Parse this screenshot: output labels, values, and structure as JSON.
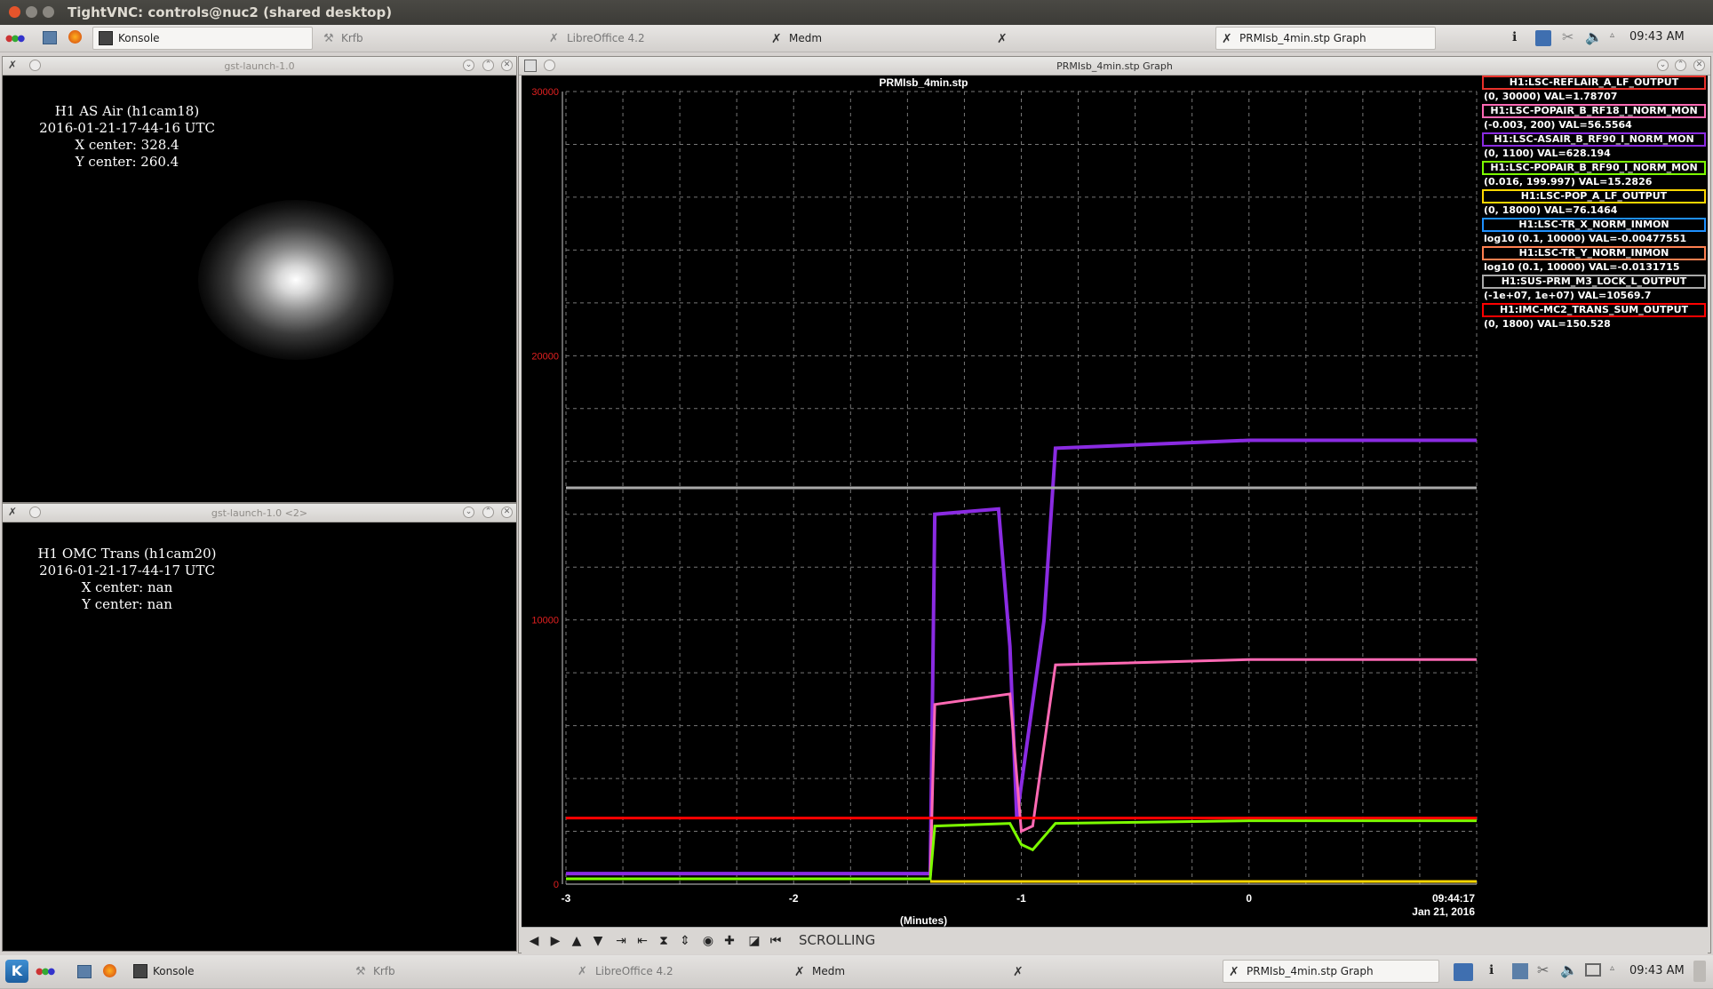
{
  "vnc": {
    "title": "TightVNC: controls@nuc2 (shared desktop)"
  },
  "top_taskbar": {
    "tasks": [
      {
        "label": "Konsole"
      },
      {
        "label": "Krfb"
      },
      {
        "label": "LibreOffice 4.2"
      },
      {
        "label": "Medm"
      },
      {
        "label": ""
      },
      {
        "label": "PRMIsb_4min.stp Graph"
      }
    ],
    "clock": "09:43 AM"
  },
  "bottom_taskbar": {
    "tasks": [
      {
        "label": "Konsole"
      },
      {
        "label": "Krfb"
      },
      {
        "label": "LibreOffice 4.2"
      },
      {
        "label": "Medm"
      },
      {
        "label": ""
      },
      {
        "label": "PRMIsb_4min.stp Graph"
      }
    ],
    "clock": "09:43 AM"
  },
  "camera1": {
    "window_title": "gst-launch-1.0",
    "line1": "H1 AS Air (h1cam18)",
    "line2": "2016-01-21-17-44-16 UTC",
    "line3": "X center: 328.4",
    "line4": "Y center: 260.4"
  },
  "camera2": {
    "window_title": "gst-launch-1.0 <2>",
    "line1": "H1 OMC Trans (h1cam20)",
    "line2": "2016-01-21-17-44-17 UTC",
    "line3": "X center: nan",
    "line4": "Y center: nan"
  },
  "graph_window": {
    "title": "PRMIsb_4min.stp Graph",
    "scrolling_label": "SCROLLING"
  },
  "legend": [
    {
      "name": "H1:LSC-REFLAIR_A_LF_OUTPUT",
      "range": "(0, 30000) VAL=1.78707",
      "color": "#e8312a"
    },
    {
      "name": "H1:LSC-POPAIR_B_RF18_I_NORM_MON",
      "range": "(-0.003, 200) VAL=56.5564",
      "color": "#ff69b4"
    },
    {
      "name": "H1:LSC-ASAIR_B_RF90_I_NORM_MON",
      "range": "(0, 1100) VAL=628.194",
      "color": "#8a2be2"
    },
    {
      "name": "H1:LSC-POPAIR_B_RF90_I_NORM_MON",
      "range": "(0.016, 199.997) VAL=15.2826",
      "color": "#7cfc00"
    },
    {
      "name": "H1:LSC-POP_A_LF_OUTPUT",
      "range": "(0, 18000) VAL=76.1464",
      "color": "#ffd700"
    },
    {
      "name": "H1:LSC-TR_X_NORM_INMON",
      "range": "log10 (0.1, 10000) VAL=-0.00477551",
      "color": "#1e90ff"
    },
    {
      "name": "H1:LSC-TR_Y_NORM_INMON",
      "range": "log10 (0.1, 10000) VAL=-0.0131715",
      "color": "#ff7f50"
    },
    {
      "name": "H1:SUS-PRM_M3_LOCK_L_OUTPUT",
      "range": "(-1e+07, 1e+07) VAL=10569.7",
      "color": "#a9a9a9"
    },
    {
      "name": "H1:IMC-MC2_TRANS_SUM_OUTPUT",
      "range": "(0, 1800) VAL=150.528",
      "color": "#ff0000"
    }
  ],
  "chart_data": {
    "type": "line",
    "title": "PRMIsb_4min.stp",
    "xlabel": "(Minutes)",
    "ylabel": "",
    "xlim": [
      -3,
      1
    ],
    "ylim": [
      0,
      30000
    ],
    "x_ticks": [
      "-3",
      "-2",
      "-1",
      "0"
    ],
    "y_ticks": [
      "0",
      "10000",
      "20000",
      "30000"
    ],
    "time_label": "09:44:17",
    "date_label": "Jan 21, 2016",
    "grid": true,
    "series": [
      {
        "name": "H1:LSC-ASAIR_B_RF90_I_NORM_MON",
        "color": "#8a2be2",
        "x": [
          -3,
          -1.4,
          -1.38,
          -1.1,
          -1.05,
          -1.02,
          -0.9,
          -0.85,
          0,
          1
        ],
        "y": [
          400,
          400,
          14000,
          14200,
          9000,
          2500,
          10000,
          16500,
          16800,
          16800
        ]
      },
      {
        "name": "H1:SUS-PRM_M3_LOCK_L_OUTPUT",
        "color": "#a9a9a9",
        "x": [
          -3,
          -1.5,
          -1,
          0,
          1
        ],
        "y": [
          15000,
          15000,
          15000,
          15000,
          15000
        ]
      },
      {
        "name": "H1:LSC-POPAIR_B_RF18_I_NORM_MON",
        "color": "#ff69b4",
        "x": [
          -3,
          -1.4,
          -1.38,
          -1.05,
          -1.0,
          -0.95,
          -0.85,
          0,
          1
        ],
        "y": [
          200,
          200,
          6800,
          7200,
          2000,
          2200,
          8300,
          8500,
          8500
        ]
      },
      {
        "name": "H1:LSC-POPAIR_B_RF90_I_NORM_MON",
        "color": "#7cfc00",
        "x": [
          -3,
          -1.4,
          -1.38,
          -1.05,
          -1.0,
          -0.95,
          -0.85,
          0,
          1
        ],
        "y": [
          200,
          200,
          2200,
          2300,
          1500,
          1300,
          2300,
          2400,
          2400
        ]
      },
      {
        "name": "H1:IMC-MC2_TRANS_SUM_OUTPUT",
        "color": "#ff0000",
        "x": [
          -3,
          1
        ],
        "y": [
          2500,
          2500
        ]
      },
      {
        "name": "H1:LSC-POP_A_LF_OUTPUT",
        "color": "#ffd700",
        "x": [
          -1.4,
          1
        ],
        "y": [
          100,
          100
        ]
      }
    ]
  }
}
